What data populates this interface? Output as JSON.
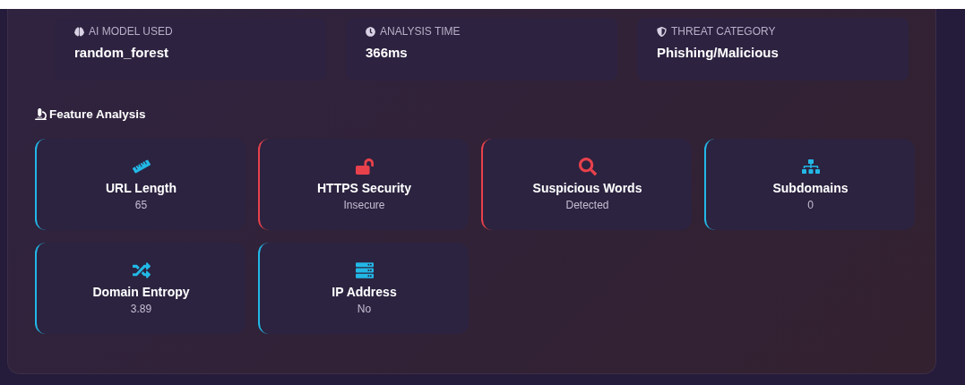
{
  "info": [
    {
      "label": "AI MODEL USED",
      "value": "random_forest"
    },
    {
      "label": "ANALYSIS TIME",
      "value": "366ms"
    },
    {
      "label": "THREAT CATEGORY",
      "value": "Phishing/Malicious"
    }
  ],
  "section_title": "Feature Analysis",
  "features": [
    {
      "name": "URL Length",
      "value": "65",
      "color": "#22b8e6"
    },
    {
      "name": "HTTPS Security",
      "value": "Insecure",
      "color": "#e8414b"
    },
    {
      "name": "Suspicious Words",
      "value": "Detected",
      "color": "#e8414b"
    },
    {
      "name": "Subdomains",
      "value": "0",
      "color": "#22b8e6"
    },
    {
      "name": "Domain Entropy",
      "value": "3.89",
      "color": "#22b8e6"
    },
    {
      "name": "IP Address",
      "value": "No",
      "color": "#22b8e6"
    }
  ]
}
